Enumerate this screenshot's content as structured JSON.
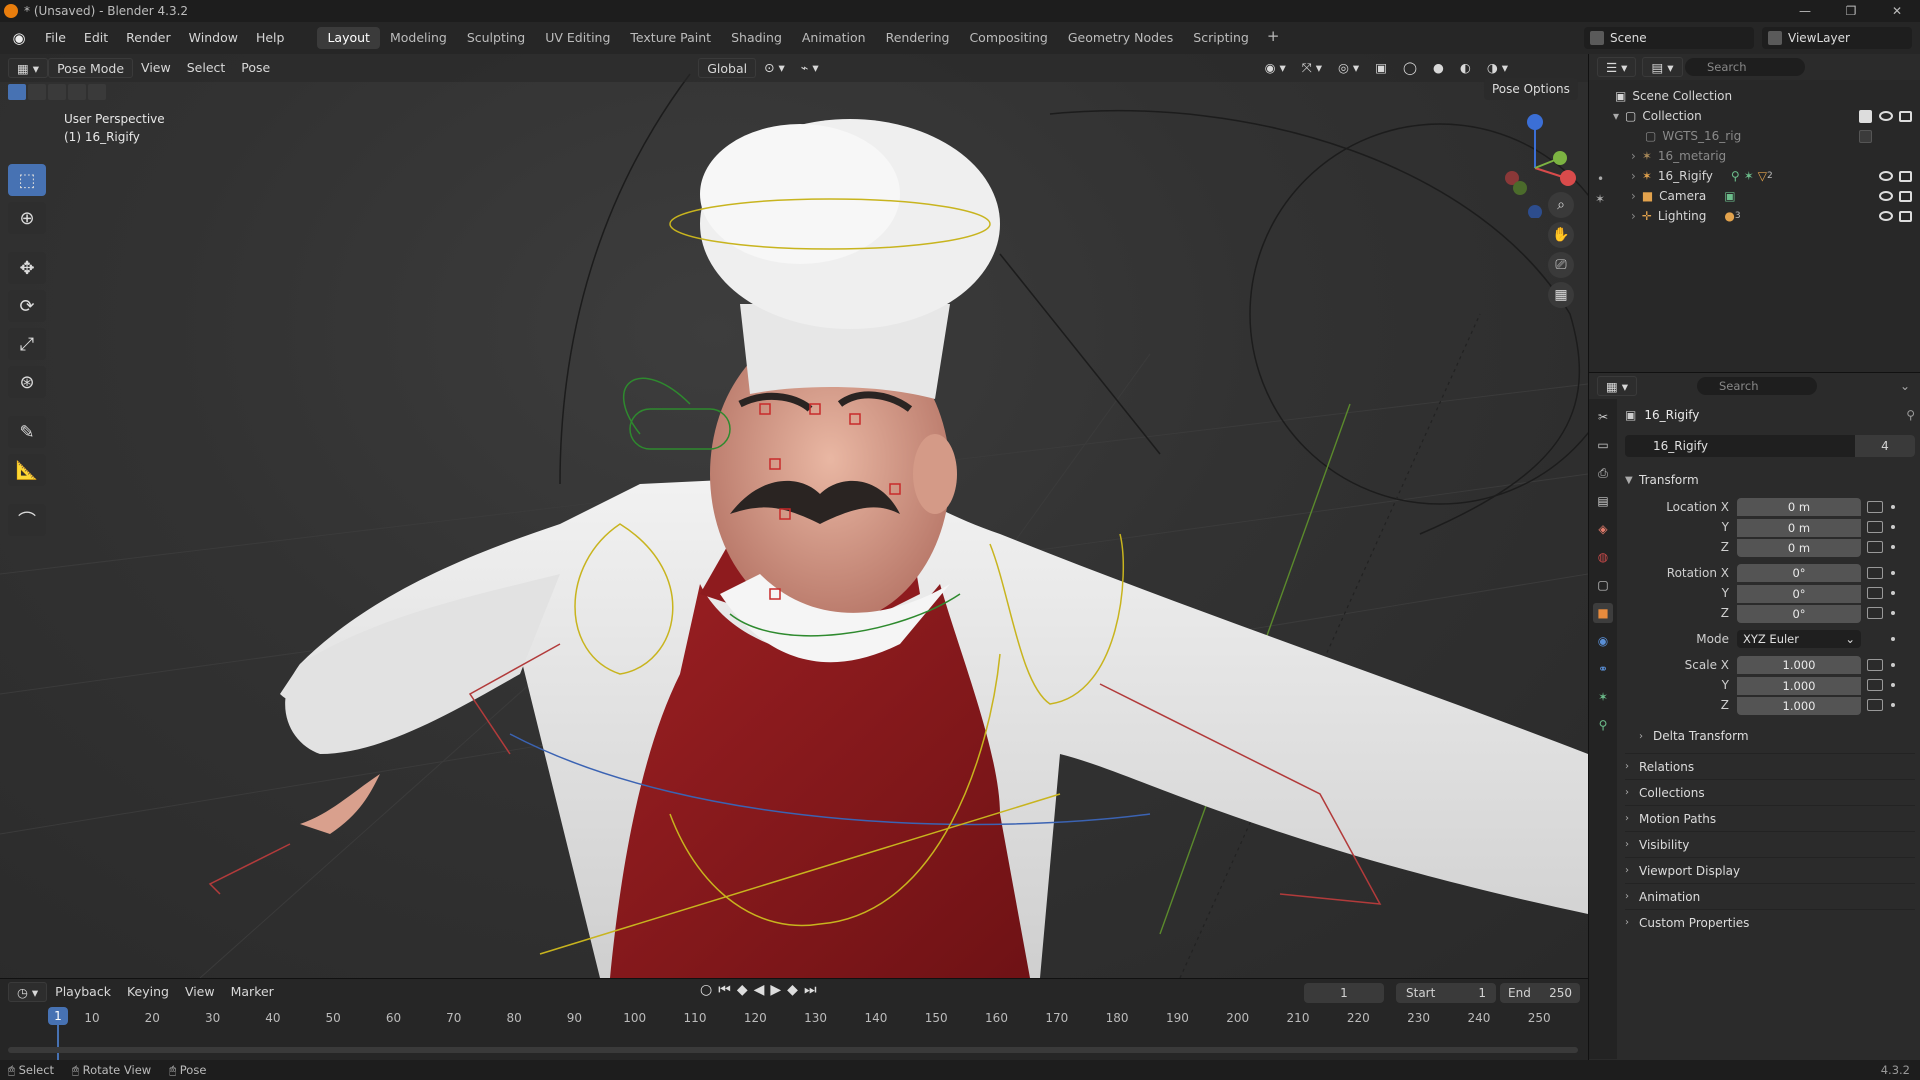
{
  "window": {
    "title": "* (Unsaved) - Blender 4.3.2"
  },
  "menu": {
    "items": [
      "File",
      "Edit",
      "Render",
      "Window",
      "Help"
    ]
  },
  "workspaces": {
    "tabs": [
      "Layout",
      "Modeling",
      "Sculpting",
      "UV Editing",
      "Texture Paint",
      "Shading",
      "Animation",
      "Rendering",
      "Compositing",
      "Geometry Nodes",
      "Scripting"
    ],
    "active": "Layout",
    "add_label": "+"
  },
  "scene": {
    "name": "Scene",
    "view_layer": "ViewLayer"
  },
  "viewport": {
    "mode": "Pose Mode",
    "menus": [
      "View",
      "Select",
      "Pose"
    ],
    "orientation": "Global",
    "overlay_line1": "User Perspective",
    "overlay_line2": "(1) 16_Rigify",
    "pose_options": "Pose Options"
  },
  "outliner": {
    "search_placeholder": "Search",
    "rows": [
      {
        "name": "Scene Collection",
        "indent": 0
      },
      {
        "name": "Collection",
        "indent": 1
      },
      {
        "name": "WGTS_16_rig",
        "indent": 2
      },
      {
        "name": "16_metarig",
        "indent": 2
      },
      {
        "name": "16_Rigify",
        "indent": 2
      },
      {
        "name": "Camera",
        "indent": 2
      },
      {
        "name": "Lighting",
        "indent": 2
      }
    ],
    "badges": {
      "rigify_count": "2",
      "lighting_count": "3"
    }
  },
  "properties": {
    "search_placeholder": "Search",
    "object_name": "16_Rigify",
    "data_name": "16_Rigify",
    "users": "4",
    "transform_label": "Transform",
    "location": {
      "label_x": "Location X",
      "x": "0 m",
      "y": "0 m",
      "z": "0 m"
    },
    "rotation": {
      "label_x": "Rotation X",
      "x": "0°",
      "y": "0°",
      "z": "0°"
    },
    "mode_label": "Mode",
    "mode_value": "XYZ Euler",
    "scale": {
      "label_x": "Scale X",
      "x": "1.000",
      "y": "1.000",
      "z": "1.000"
    },
    "axis_y": "Y",
    "axis_z": "Z",
    "delta_transform": "Delta Transform",
    "panels": [
      "Relations",
      "Collections",
      "Motion Paths",
      "Visibility",
      "Viewport Display",
      "Animation",
      "Custom Properties"
    ]
  },
  "timeline": {
    "menus": [
      "Playback",
      "Keying",
      "View",
      "Marker"
    ],
    "current_frame": "1",
    "start_label": "Start",
    "start": "1",
    "end_label": "End",
    "end": "250",
    "ticks": [
      "10",
      "20",
      "30",
      "40",
      "50",
      "60",
      "70",
      "80",
      "90",
      "100",
      "110",
      "120",
      "130",
      "140",
      "150",
      "160",
      "170",
      "180",
      "190",
      "200",
      "210",
      "220",
      "230",
      "240",
      "250"
    ],
    "playhead": "1"
  },
  "statusbar": {
    "items": [
      "Select",
      "Rotate View",
      "Pose"
    ],
    "version": "4.3.2"
  }
}
